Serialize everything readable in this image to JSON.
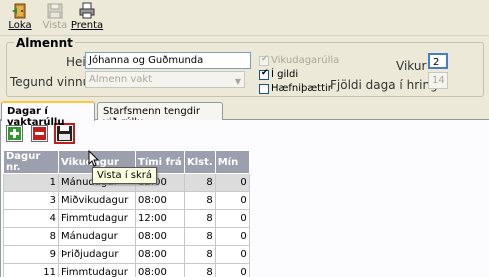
{
  "toolbar": {
    "loka_label": "Loka",
    "vista_label": "Vista",
    "prenta_label": "Prenta"
  },
  "almennt": {
    "title": "Almennt",
    "heiti_label": "Heiti",
    "heiti_value": "Jóhanna og Guðmunda",
    "tegund_label": "Tegund vinnu",
    "tegund_value": "Almenn vakt",
    "vikudagarulla_label": "Vikudagarúlla",
    "igildi_label": "Í gildi",
    "haefnipaettir_label": "Hæfniþættir",
    "vikur_label": "Vikur",
    "vikur_value": "2",
    "fjoldi_label": "Fjöldi daga í hring",
    "fjoldi_value": "14"
  },
  "tabs": [
    {
      "label": "Dagar í vaktarúllu"
    },
    {
      "label": "Starfsmenn tengdir við rúllu"
    }
  ],
  "grid": {
    "headers": [
      "Dagur nr.",
      "Vikudagur",
      "Tími frá",
      "Klst.",
      "Mín"
    ],
    "rows": [
      {
        "dagur": "1",
        "vikudagur": "Mánudagur",
        "timi": "12:00",
        "klst": "8",
        "min": "0"
      },
      {
        "dagur": "3",
        "vikudagur": "Miðvikudagur",
        "timi": "08:00",
        "klst": "8",
        "min": "0"
      },
      {
        "dagur": "4",
        "vikudagur": "Fimmtudagur",
        "timi": "12:00",
        "klst": "8",
        "min": "0"
      },
      {
        "dagur": "8",
        "vikudagur": "Mánudagur",
        "timi": "08:00",
        "klst": "8",
        "min": "0"
      },
      {
        "dagur": "9",
        "vikudagur": "Þriðjudagur",
        "timi": "08:00",
        "klst": "8",
        "min": "0"
      },
      {
        "dagur": "11",
        "vikudagur": "Fimmtudagur",
        "timi": "08:00",
        "klst": "8",
        "min": "0"
      }
    ]
  },
  "tooltip": "Vista í skrá",
  "icons": {
    "add": "plus-icon",
    "remove": "minus-icon",
    "save": "floppy-disk-icon"
  }
}
